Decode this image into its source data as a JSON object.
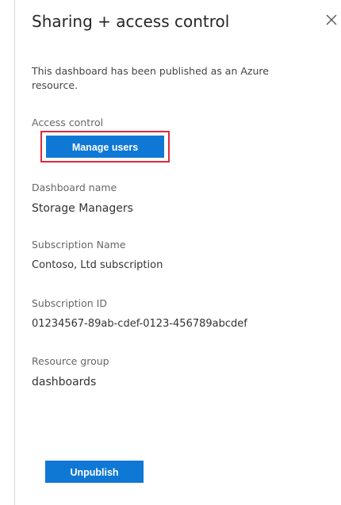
{
  "panel": {
    "title": "Sharing + access control",
    "close_icon": "close-icon",
    "description": "This dashboard has been published as an Azure resource."
  },
  "access_control": {
    "label": "Access control",
    "manage_users_label": "Manage users"
  },
  "fields": {
    "dashboard_name": {
      "label": "Dashboard name",
      "value": "Storage Managers"
    },
    "subscription_name": {
      "label": "Subscription Name",
      "value": "Contoso, Ltd subscription"
    },
    "subscription_id": {
      "label": "Subscription ID",
      "value": "01234567-89ab-cdef-0123-456789abcdef"
    },
    "resource_group": {
      "label": "Resource group",
      "value": "dashboards"
    }
  },
  "actions": {
    "unpublish_label": "Unpublish"
  },
  "colors": {
    "accent": "#0f78d4",
    "highlight": "#e0293b"
  }
}
